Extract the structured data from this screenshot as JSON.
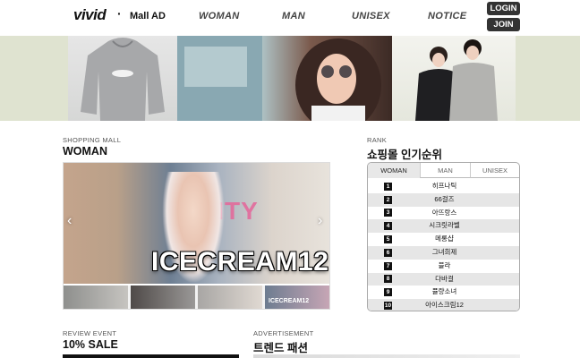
{
  "header": {
    "brand": "vivid",
    "dot": "·",
    "subtitle": "Mall AD",
    "nav": [
      "WOMAN",
      "MAN",
      "UNISEX",
      "NOTICE"
    ],
    "login": "LOGIN",
    "join": "JOIN"
  },
  "woman": {
    "subtitle": "SHOPPING MALL",
    "title": "WOMAN",
    "slide_text": "ICECREAM12",
    "slide_sign": "CITY",
    "prev": "‹",
    "next": "›",
    "thumbs": [
      "",
      "",
      "",
      "ICECREAM12"
    ]
  },
  "rank": {
    "subtitle": "RANK",
    "title": "쇼핑몰 인기순위",
    "tabs": [
      "WOMAN",
      "MAN",
      "UNISEX"
    ],
    "active_tab": "WOMAN",
    "items": [
      {
        "num": "1",
        "name": "히프나틱"
      },
      {
        "num": "2",
        "name": "66걸즈"
      },
      {
        "num": "3",
        "name": "아뜨랑스"
      },
      {
        "num": "4",
        "name": "시크릿라벨"
      },
      {
        "num": "5",
        "name": "메롱샵"
      },
      {
        "num": "6",
        "name": "그녀희제"
      },
      {
        "num": "7",
        "name": "블라"
      },
      {
        "num": "8",
        "name": "다바걸"
      },
      {
        "num": "9",
        "name": "퓰량소녀"
      },
      {
        "num": "10",
        "name": "아이스크림12"
      }
    ]
  },
  "event": {
    "subtitle": "REVIEW EVENT",
    "title": "10% SALE"
  },
  "ad": {
    "subtitle": "ADVERTISEMENT",
    "title": "트렌드 패션"
  }
}
